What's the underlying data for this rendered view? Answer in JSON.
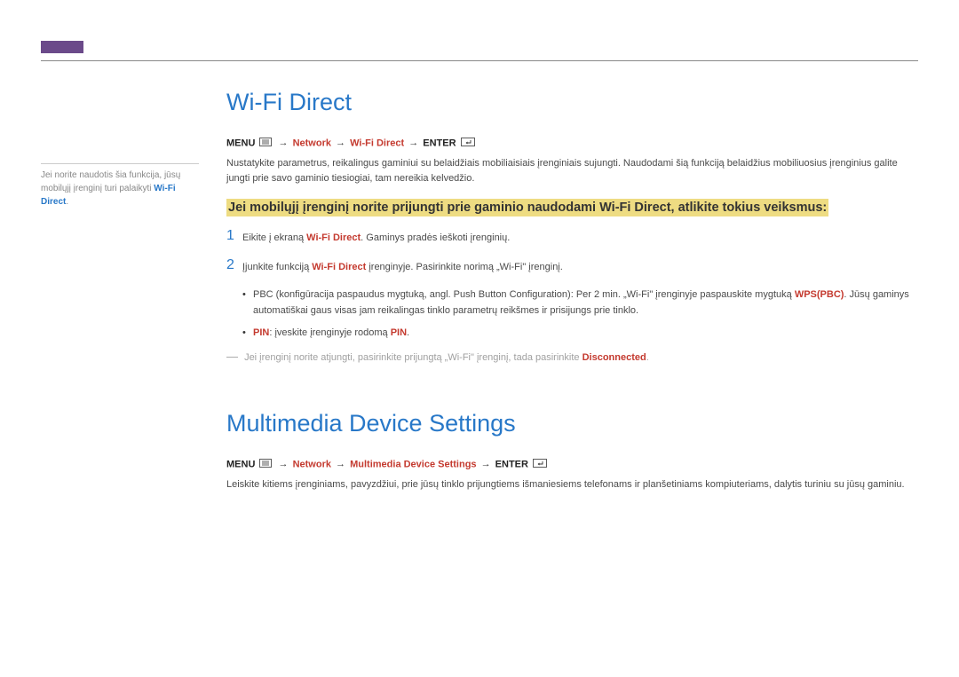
{
  "sidebar": {
    "text_a": "Jei norite naudotis šia funkcija, jūsų mobilųjį įrenginį turi palaikyti ",
    "wifi": "Wi-Fi Direct",
    "text_b": "."
  },
  "section1": {
    "title": "Wi-Fi Direct",
    "menu_label": "MENU",
    "path1": "Network",
    "path2": "Wi-Fi Direct",
    "enter_label": "ENTER",
    "intro": "Nustatykite parametrus, reikalingus gaminiui su belaidžiais mobiliaisiais įrenginiais sujungti. Naudodami šią funkciją belaidžius mobiliuosius įrenginius galite jungti prie savo gaminio tiesiogiai, tam nereikia kelvedžio.",
    "highlight": "Jei mobilųjį įrenginį norite prijungti prie gaminio naudodami Wi-Fi Direct, atlikite tokius veiksmus:",
    "step1_a": "Eikite į ekraną ",
    "step1_red": "Wi-Fi Direct",
    "step1_b": ". Gaminys pradės ieškoti įrenginių.",
    "step2_a": "Įjunkite funkciją ",
    "step2_red": "Wi-Fi Direct",
    "step2_b": " įrenginyje. Pasirinkite norimą „Wi-Fi\" įrenginį.",
    "bullet1_a": "PBC (konfigūracija paspaudus mygtuką, angl. Push Button Configuration): Per 2 min. „Wi-Fi\" įrenginyje paspauskite mygtuką ",
    "bullet1_red": "WPS(PBC)",
    "bullet1_b": ". Jūsų gaminys automatiškai gaus visas jam reikalingas tinklo parametrų reikšmes ir prisijungs prie tinklo.",
    "bullet2_red1": "PIN",
    "bullet2_a": ": įveskite įrenginyje rodomą ",
    "bullet2_red2": "PIN",
    "bullet2_b": ".",
    "note_a": "Jei įrenginį norite atjungti, pasirinkite prijungtą „Wi-Fi\" įrenginį, tada pasirinkite ",
    "note_red": "Disconnected",
    "note_b": "."
  },
  "section2": {
    "title": "Multimedia Device Settings",
    "menu_label": "MENU",
    "path1": "Network",
    "path2": "Multimedia Device Settings",
    "enter_label": "ENTER",
    "body": "Leiskite kitiems įrenginiams, pavyzdžiui, prie jūsų tinklo prijungtiems išmaniesiems telefonams ir planšetiniams kompiuteriams, dalytis turiniu su jūsų gaminiu."
  },
  "arrow": "→"
}
